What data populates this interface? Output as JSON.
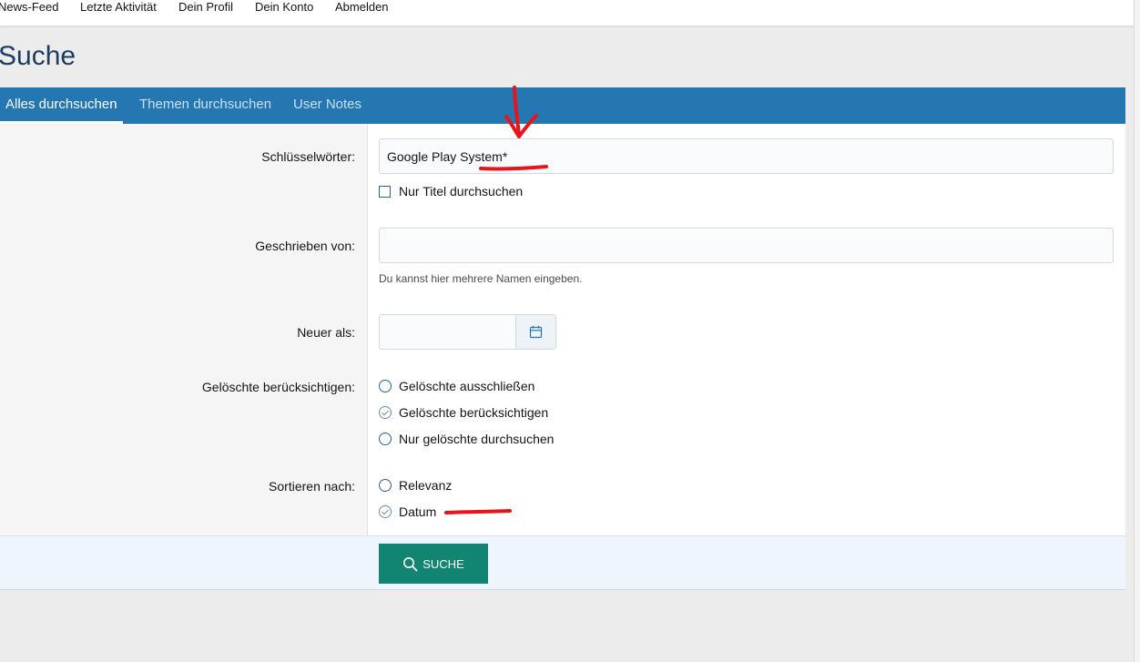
{
  "topnav": {
    "items": [
      "News-Feed",
      "Letzte Aktivität",
      "Dein Profil",
      "Dein Konto",
      "Abmelden"
    ]
  },
  "page": {
    "title": "Suche"
  },
  "tabs": [
    {
      "label": "Alles durchsuchen",
      "active": true
    },
    {
      "label": "Themen durchsuchen",
      "active": false
    },
    {
      "label": "User Notes",
      "active": false
    }
  ],
  "form": {
    "keywords": {
      "label": "Schlüsselwörter:",
      "value": "Google Play System*",
      "title_only_label": "Nur Titel durchsuchen",
      "title_only_checked": false
    },
    "author": {
      "label": "Geschrieben von:",
      "value": "",
      "hint": "Du kannst hier mehrere Namen eingeben."
    },
    "newer_than": {
      "label": "Neuer als:",
      "value": ""
    },
    "deleted": {
      "label": "Gelöschte berücksichtigen:",
      "options": [
        {
          "label": "Gelöschte ausschließen",
          "checked": false
        },
        {
          "label": "Gelöschte berücksichtigen",
          "checked": true
        },
        {
          "label": "Nur gelöschte durchsuchen",
          "checked": false
        }
      ]
    },
    "sort": {
      "label": "Sortieren nach:",
      "options": [
        {
          "label": "Relevanz",
          "checked": false
        },
        {
          "label": "Datum",
          "checked": true
        }
      ]
    },
    "submit_label": "SUCHE"
  },
  "colors": {
    "tab_bar": "#2577b1",
    "submit": "#128572",
    "title": "#1d3c5f",
    "annotation": "#e8141b"
  },
  "icons": {
    "submit": "search-icon",
    "date": "calendar-icon"
  }
}
